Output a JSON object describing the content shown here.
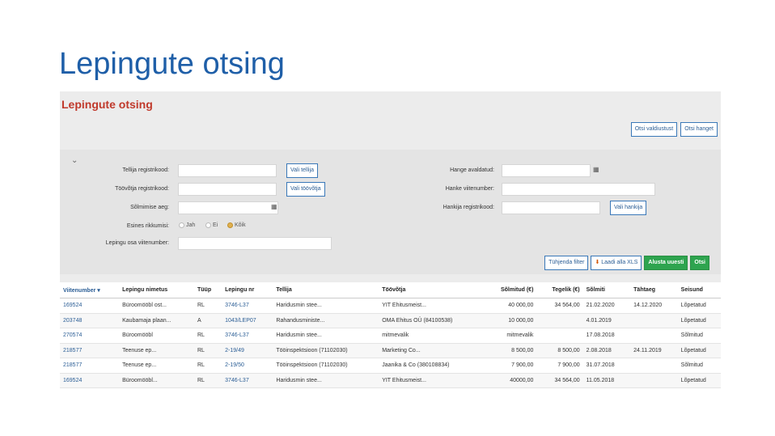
{
  "slide": {
    "title": "Lepingute otsing"
  },
  "app": {
    "title": "Lepingute otsing",
    "top_buttons": {
      "otsi_valdkust": "Otsi valdiustust",
      "otsi_hanget": "Otsi hanget"
    }
  },
  "filter": {
    "labels": {
      "tellija_reg": "Tellija registrikood:",
      "toovotja_reg": "Töövõtja registrikood:",
      "solmimise_aeg": "Sõlmimise aeg:",
      "esines_rikkumisi": "Esines rikkumisi:",
      "lepingu_viitenumber": "Lepingu osa viitenumber:",
      "hange_avaldatud": "Hange avaldatud:",
      "hanke_viitenumber": "Hanke viitenumber:",
      "hankija_reg": "Hankija registrikood:"
    },
    "buttons": {
      "vali_tellija": "Vali tellija",
      "vali_toovotja": "Vali töövõtja",
      "vali_hankija": "Vali hankija",
      "tuhjenda": "Tühjenda filter",
      "laadi_xls": "Laadi alla XLS",
      "alusta_uuesti": "Alusta uuesti",
      "otsi": "Otsi"
    },
    "radio": {
      "jah": "Jah",
      "ei": "Ei",
      "koik": "Kõik"
    }
  },
  "table": {
    "columns": [
      "Viitenumber ▾",
      "Lepingu nimetus",
      "Tüüp",
      "Lepingu nr",
      "Tellija",
      "Töövõtja",
      "Sõlmitud (€)",
      "Tegelik (€)",
      "Sõlmiti",
      "Tähtaeg",
      "Seisund"
    ],
    "rows": [
      [
        "169524",
        "Büroomööbl ost...",
        "RL",
        "3746-L37",
        "Haridusmin stee...",
        "YIT Ehitusmeist...",
        "40 000,00",
        "34 564,00",
        "21.02.2020",
        "14.12.2020",
        "Lõpetatud"
      ],
      [
        "203748",
        "Kaubamaja plaan...",
        "A",
        "1043/LEP07",
        "Rahandusministe...",
        "OMA Ehitus OÜ (84100538)",
        "10 000,00",
        "",
        "4.01.2019",
        "",
        "Lõpetatud"
      ],
      [
        "270574",
        "Büroomööbl",
        "RL",
        "3746-L37",
        "Haridusmin stee...",
        "mitmevalik",
        "mitmevalik",
        "",
        "17.08.2018",
        "",
        "Sõlmitud"
      ],
      [
        "218577",
        "Teenuse ep...",
        "RL",
        "2-19/49",
        "Tööinspektsioon (71102030)",
        "Marketing Co...",
        "8 500,00",
        "8 500,00",
        "2.08.2018",
        "24.11.2019",
        "Lõpetatud"
      ],
      [
        "218577",
        "Teenuse ep...",
        "RL",
        "2-19/50",
        "Tööinspektsioon (71102030)",
        "Jaanika & Co (380108834)",
        "7 900,00",
        "7 900,00",
        "31.07.2018",
        "",
        "Sõlmitud"
      ],
      [
        "169524",
        "Büroomööbl...",
        "RL",
        "3746-L37",
        "Haridusmin stee...",
        "YIT Ehitusmeist...",
        "40000,00",
        "34 564,00",
        "11.05.2018",
        "",
        "Lõpetatud"
      ]
    ]
  },
  "colors": {
    "slide_title": "#1f5fa8",
    "app_title": "#c0392b",
    "link": "#2a5d95",
    "green": "#2ea44f"
  }
}
